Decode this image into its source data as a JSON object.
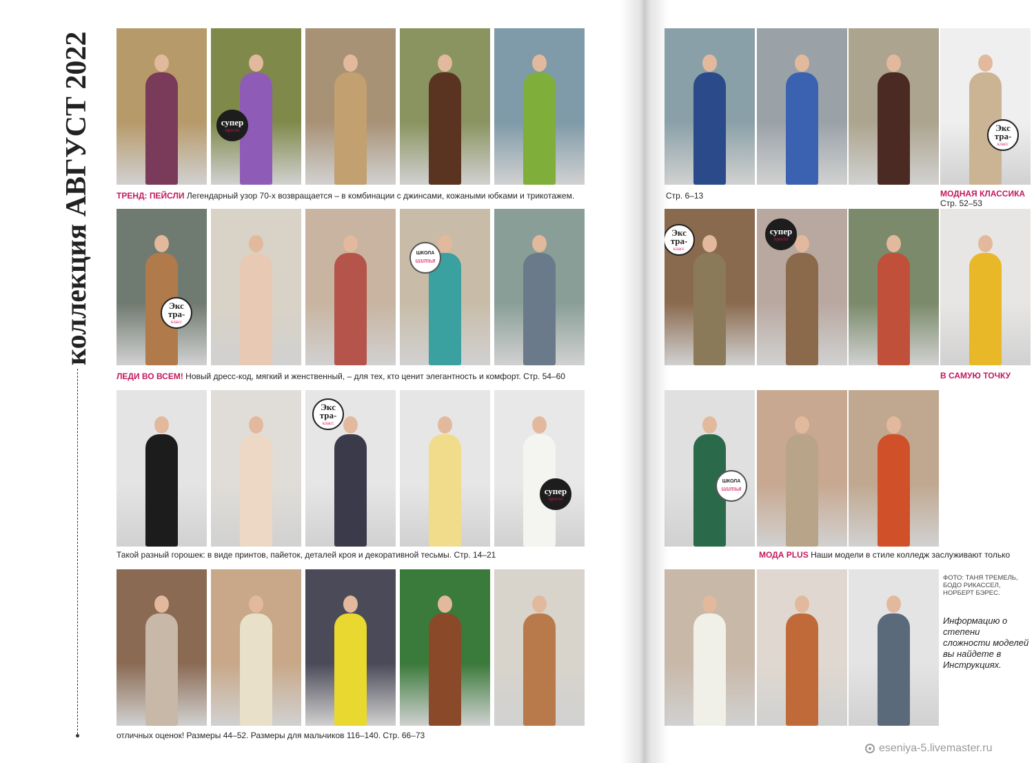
{
  "spine": {
    "title_text": "коллекция АВГУСТ 2022"
  },
  "captions": {
    "trend": {
      "highlight": "ТРЕНД: ПЕЙСЛИ",
      "text": " Легендарный узор 70-х возвращается – в комбинации с джинсами, кожаными юбками и трикотажем."
    },
    "trend_pages": {
      "text": "Стр. 6–13"
    },
    "classic": {
      "highlight": "МОДНАЯ КЛАССИКА",
      "pages": "Стр. 52–53"
    },
    "ladies": {
      "highlight": "ЛЕДИ ВО ВСЕМ!",
      "text": " Новый дресс-код, мягкий и женственный, – для тех, кто ценит элегантность и комфорт. Стр. 54–60"
    },
    "point": {
      "highlight": "В САМУЮ ТОЧКУ"
    },
    "dots": {
      "text": "Такой разный горошек: в виде принтов, пайеток, деталей кроя и декоративной тесьмы. Стр. 14–21"
    },
    "plus": {
      "highlight": "МОДА PLUS",
      "text": " Наши модели в стиле колледж заслуживают только"
    },
    "grades": {
      "text": "отличных оценок! Размеры 44–52. Размеры для мальчиков 116–140. Стр. 66–73"
    }
  },
  "credits": {
    "text": "ФОТО: ТАНЯ ТРЕМЕЛЬ, БОДО РИКАССЕЛ, НОРБЕРТ БЭРЕС."
  },
  "info": {
    "text": "Информацию о степени сложности моделей вы найдете в Инструкциях."
  },
  "badges": {
    "super_top": "супер",
    "super_bottom": "просто",
    "extra_top": "Экс тра-",
    "extra_bottom": "класс",
    "school_top": "ШКОЛА",
    "school_bottom": "шитья"
  },
  "watermark": {
    "text": "eseniya-5.livemaster.ru"
  },
  "photos": [
    {
      "id": "l1-1",
      "bg": "#b79a6a",
      "garment": "#7a3a5a"
    },
    {
      "id": "l1-2",
      "bg": "#7f8a4a",
      "garment": "#8e5cb6",
      "badge": "super"
    },
    {
      "id": "l1-3",
      "bg": "#a89276",
      "garment": "#c2a070"
    },
    {
      "id": "l1-4",
      "bg": "#8a9460",
      "garment": "#5a3420"
    },
    {
      "id": "l1-5",
      "bg": "#7f9aa8",
      "garment": "#7fae3a"
    },
    {
      "id": "r1-1",
      "bg": "#8aa0a8",
      "garment": "#2b4a8a"
    },
    {
      "id": "r1-2",
      "bg": "#9aa2a8",
      "garment": "#3a62b0"
    },
    {
      "id": "r1-3",
      "bg": "#aca48e",
      "garment": "#4a2a22"
    },
    {
      "id": "r1-4",
      "bg": "#efefef",
      "garment": "#cbb493",
      "badge": "extra"
    },
    {
      "id": "l2-1",
      "bg": "#6f7a70",
      "garment": "#b07a4a",
      "badge": "extra"
    },
    {
      "id": "l2-2",
      "bg": "#d9d2c6",
      "garment": "#e8cab4"
    },
    {
      "id": "l2-3",
      "bg": "#c8b4a0",
      "garment": "#b5544a"
    },
    {
      "id": "l2-4",
      "bg": "#c8bca8",
      "garment": "#3aa0a0",
      "badge": "school"
    },
    {
      "id": "l2-5",
      "bg": "#8a9e98",
      "garment": "#6a7a8a"
    },
    {
      "id": "r2-1",
      "bg": "#8a6a4e",
      "garment": "#8a7a5a",
      "badge": "extra"
    },
    {
      "id": "r2-2",
      "bg": "#b8a8a0",
      "garment": "#8a6a4a",
      "badge": "super"
    },
    {
      "id": "r2-3",
      "bg": "#7a8a6a",
      "garment": "#c0503a"
    },
    {
      "id": "r2-4",
      "bg": "#e8e6e4",
      "garment": "#e8b828"
    },
    {
      "id": "l3-1",
      "bg": "#e4e4e4",
      "garment": "#1c1c1c"
    },
    {
      "id": "l3-2",
      "bg": "#e0ddd8",
      "garment": "#ecd8c4"
    },
    {
      "id": "l3-3",
      "bg": "#e6e6e6",
      "garment": "#3a3a4a",
      "badge": "extra"
    },
    {
      "id": "l3-4",
      "bg": "#e6e6e6",
      "garment": "#f0dc8a"
    },
    {
      "id": "l3-5",
      "bg": "#e8e8e8",
      "garment": "#f4f4f0",
      "badge": "super"
    },
    {
      "id": "r3-1",
      "bg": "#e0e0e0",
      "garment": "#2a6a4a",
      "badge": "school"
    },
    {
      "id": "r3-2",
      "bg": "#c8a890",
      "garment": "#b8a488"
    },
    {
      "id": "r3-3",
      "bg": "#c0a890",
      "garment": "#d0502a"
    },
    {
      "id": "l4-1",
      "bg": "#8a6a52",
      "garment": "#c8b8a8"
    },
    {
      "id": "l4-2",
      "bg": "#c8a888",
      "garment": "#e8e0c8"
    },
    {
      "id": "l4-3",
      "bg": "#4a4a58",
      "garment": "#e8d830"
    },
    {
      "id": "l4-4",
      "bg": "#3a7a3a",
      "garment": "#8a4a2a"
    },
    {
      "id": "l4-5",
      "bg": "#d8d4cc",
      "garment": "#b87a4a"
    },
    {
      "id": "r4-1",
      "bg": "#c8b8a8",
      "garment": "#f0f0e8"
    },
    {
      "id": "r4-2",
      "bg": "#e0d8d0",
      "garment": "#c06a3a"
    },
    {
      "id": "r4-3",
      "bg": "#e4e4e4",
      "garment": "#5a6a7a"
    }
  ]
}
